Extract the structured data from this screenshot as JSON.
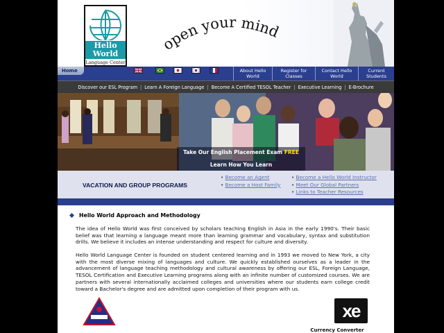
{
  "logo": {
    "line1": "Hello",
    "line2": "World",
    "sub": "Language Center"
  },
  "slogan": "open your mind",
  "nav": {
    "home": "Home",
    "links": [
      {
        "label": "About Hello World"
      },
      {
        "label": "Register for Classes"
      },
      {
        "label": "Contact Hello World"
      },
      {
        "label": "Current Students"
      }
    ],
    "flags": [
      "uk-flag-icon",
      "brazil-flag-icon",
      "japan-flag-icon",
      "korea-flag-icon",
      "france-flag-icon"
    ]
  },
  "subnav": {
    "items": [
      "Discover our ESL Program",
      "Learn A Foreign Language",
      "Become A Certified TESOL Teacher",
      "Executive Learning",
      "E-Brochure"
    ]
  },
  "banner": {
    "cta_line1": "Take Our English Placement Exam",
    "cta_free": "FREE",
    "cta_line2": "Learn How You Learn"
  },
  "programs": {
    "title": "VACATION AND GROUP PROGRAMS",
    "links_left": [
      "Become an Agent",
      "Become a Host Family"
    ],
    "links_right": [
      "Become a Hello World Instructor",
      "Meet Our Global Partners",
      "Links to Teacher Resources"
    ]
  },
  "content": {
    "title": "Hello World Approach and Methodology",
    "para1": "The idea of Hello World was first conceived by scholars teaching English in Asia in the early 1990's. Their basic belief was that learning a language meant more than learning grammar and vocabulary, syntax and substitution drills. We believe it includes an intense understanding and respect for culture and diversity.",
    "para2": "Hello World Language Center is founded on student centered learning and in 1993 we moved to New York, a city with the most diverse mixing of languages and culture. We quickly established ourselves as a leader in the advancement of language teaching methodology and cultural awareness by offering our ESL, Foreign Language, TESOL Certification and Executive Learning programs along with an infinite number of customized courses. We are partners with several internationally acclaimed colleges and universities where our students earn college credit toward a Bachelor's degree and are admitted upon completion of their program with us.",
    "xe_logo": "xe",
    "currency_caption": "Currency Converter"
  },
  "colors": {
    "nav_blue": "#2b3f8f",
    "teal": "#1d9aa8",
    "dark_bar": "#3a3a3a"
  }
}
